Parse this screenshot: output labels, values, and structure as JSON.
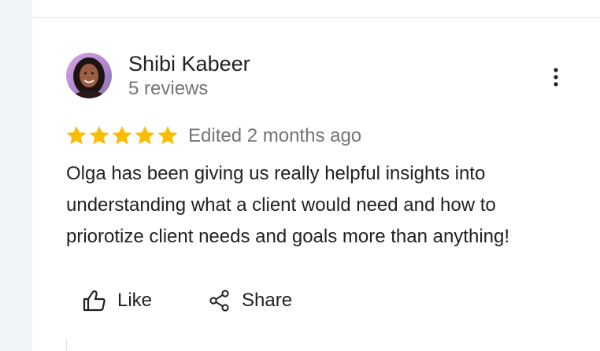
{
  "review": {
    "reviewer_name": "Shibi Kabeer",
    "review_count": "5 reviews",
    "rating": 5,
    "rating_max": 5,
    "edited": "Edited 2 months ago",
    "text": "Olga has been giving us really helpful insights into understanding what a client would need and how to priorotize client needs and goals more than anything!",
    "star_color": "#fbbc04"
  },
  "actions": {
    "like_label": "Like",
    "share_label": "Share"
  },
  "icons": {
    "more": "more-vert-icon",
    "like": "thumb-up-icon",
    "share": "share-icon"
  }
}
